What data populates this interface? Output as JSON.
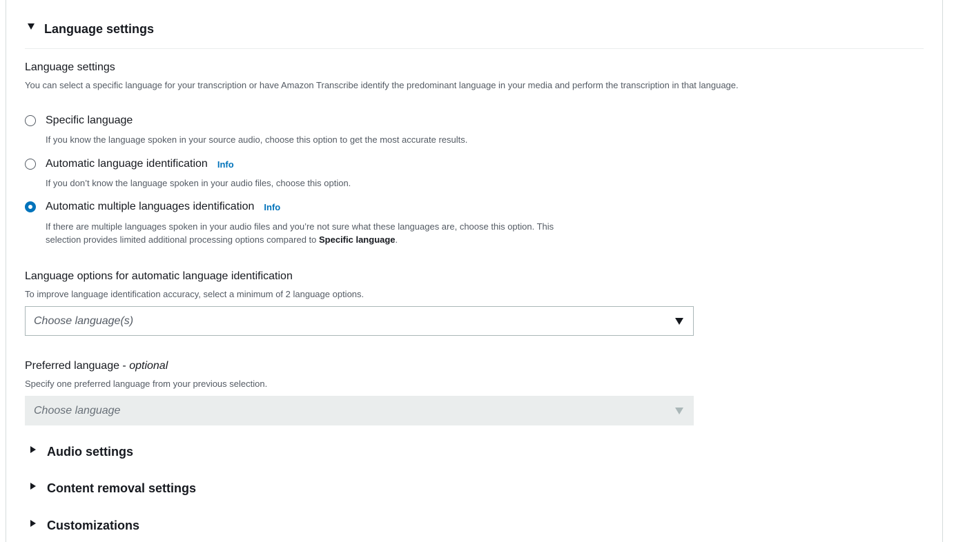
{
  "section": {
    "title": "Language settings"
  },
  "language_group": {
    "label": "Language settings",
    "description": "You can select a specific language for your transcription or have Amazon Transcribe identify the predominant language in your media and perform the transcription in that language."
  },
  "options": [
    {
      "label": "Specific language",
      "description": "If you know the language spoken in your source audio, choose this option to get the most accurate results.",
      "selected": false
    },
    {
      "label": "Automatic language identification",
      "info": "Info",
      "description": "If you don’t know the language spoken in your audio files, choose this option.",
      "selected": false
    },
    {
      "label": "Automatic multiple languages identification",
      "info": "Info",
      "description_line1": "If there are multiple languages spoken in your audio files and you’re not sure what these languages are, choose this option. This",
      "description_line2_prefix": "selection provides limited additional processing options compared to ",
      "description_line2_bold": "Specific language",
      "description_line2_suffix": ".",
      "selected": true
    }
  ],
  "language_options": {
    "label": "Language options for automatic language identification",
    "description": "To improve language identification accuracy, select a minimum of 2 language options.",
    "placeholder": "Choose language(s)"
  },
  "preferred_language": {
    "label_prefix": "Preferred language - ",
    "label_optional": "optional",
    "description": "Specify one preferred language from your previous selection.",
    "placeholder": "Choose language",
    "disabled": true
  },
  "expanders": [
    {
      "title": "Audio settings"
    },
    {
      "title": "Content removal settings"
    },
    {
      "title": "Customizations"
    }
  ],
  "colors": {
    "accent": "#0073bb",
    "text": "#16191f",
    "muted": "#545b64",
    "border": "#aab7b8",
    "disabled_bg": "#eaeded"
  },
  "icons": {
    "expanded": "caret-down-icon",
    "collapsed": "caret-right-icon",
    "dropdown": "dropdown-arrow-icon"
  }
}
